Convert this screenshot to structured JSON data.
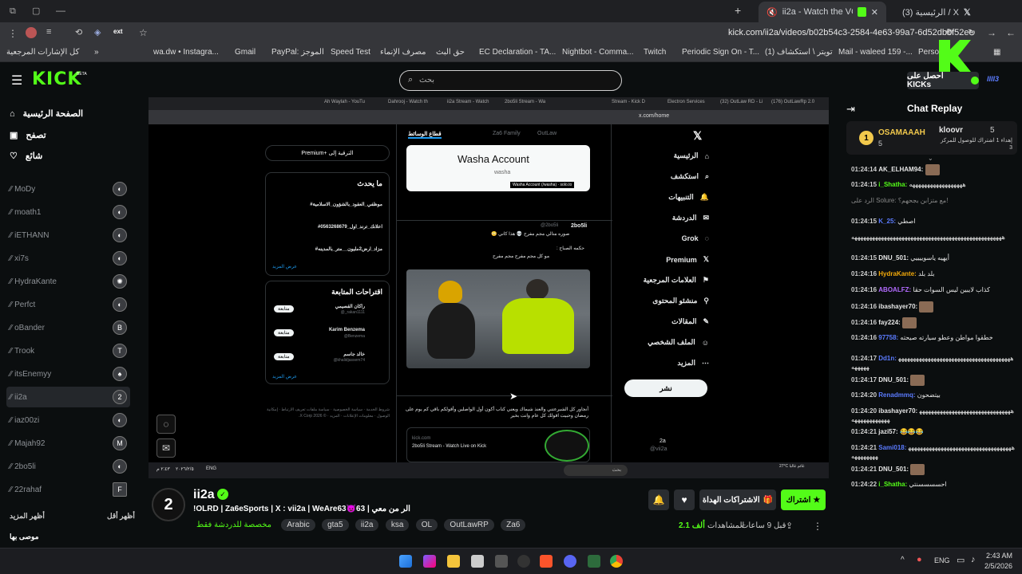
{
  "browser": {
    "tabs": [
      {
        "label": "ii2a - Watch the VOD on Ki",
        "active": true
      },
      {
        "label": "X / الرئيسية (3)",
        "active": false
      }
    ],
    "url": "kick.com/ii2a/videos/b02b54c3-2584-4e63-99a7-6d52dbbf52ee",
    "bookmarks": [
      "كل الإشارات المرجعية",
      "wa.dw • Instagra...",
      "Gmail",
      "PayPal: الموجز",
      "Speed Test",
      "مصرف الإنماء",
      "حق البث",
      "EC Declaration - TA...",
      "Nightbot - Comma...",
      "Twitch",
      "Periodic Sign On - T...",
      "(1) تويتر \\ استكشاف",
      "Mail - waleed 159 -...",
      "Perso"
    ]
  },
  "kick": {
    "logo": "KICK",
    "beta": "BETA",
    "search_placeholder": "بحث",
    "get_kicks": "احصل على KICKs"
  },
  "sidebar": {
    "nav": [
      {
        "label": "الصفحة الرئيسية",
        "icon": "home-icon"
      },
      {
        "label": "تصفح",
        "icon": "browse-icon"
      },
      {
        "label": "شائع",
        "icon": "heart-icon"
      }
    ],
    "channels": [
      "MoDy",
      "moath1",
      "iETHANN",
      "xi7s",
      "HydraKante",
      "Perfct",
      "oBander",
      "Trook",
      "itsEnemyy",
      "ii2a",
      "iaz00zi",
      "Majah92",
      "2bo5li",
      "22rahaf"
    ],
    "show_more": "أظهر المزيد",
    "show_less": "أظهر أقل",
    "recommended": "موصى بها"
  },
  "video_content": {
    "x_tabs": [
      "Ah Waylah - YouTu",
      "Dahrooj - Watch th",
      "ii2a Stream - Watch",
      "2bo5li Stream - Wa",
      "Stream - Kick D",
      "Electron Services",
      "(32) OutLaw RD - Li",
      "(176) OutLawRp 2.0"
    ],
    "x_url": "x.com/home",
    "x_nav": [
      "الرئيسية",
      "استكشف",
      "التنبيهات",
      "الدردشة",
      "Grok",
      "Premium",
      "العلامات المرجعية",
      "منشئو المحتوى",
      "المقالات",
      "الملف الشخصي",
      "المزيد"
    ],
    "post_button": "نشر",
    "profile_name": "2a",
    "profile_handle": "@vii2a",
    "feed_tab": "قطاع الوسائط",
    "feed_tabs_other": [
      "Za6 Family",
      "OutLaw"
    ],
    "card_title": "Washa Account",
    "card_sub": "washa",
    "card_caption": "Washa Account (/washa) · solo.to",
    "post1_user": "2bo5li",
    "post1_handle": "@2bo5li",
    "post1_text1": "صوره متالي مجم مفرح 💀 هذا كاني 😳",
    "post1_text2": "حكمه الصباح :",
    "post1_text3": "مو كل مجم مفرح مجم مفرح",
    "post2_text": "أنجاور كل الشيرعتني والعنذ شيماك ويعني كناب أكون أول الواصلين وأقولكم باقي كم يوم على رمضان وحبيت اقولك كل عام وانت بخير",
    "post2_link": "kick.com",
    "post2_linktitle": "2bo5li Stream - Watch Live on Kick",
    "premium_btn": "Premium+ الترقية إلى",
    "trending_title": "ما يحدث",
    "trends": [
      "#موظفي_العقود_بالشؤون_الاسلامية",
      "#اعلانك_ترند_اول_0563268679",
      "#مزاد_ارض2مليون__متر_بالمدينه"
    ],
    "trend_more": "عرض المزيد",
    "follow_title": "اقتراحات المتابعة",
    "follows": [
      {
        "name": "راكان القصيمي",
        "handle": "@_rakan1111"
      },
      {
        "name": "Karim Benzema",
        "handle": "@Benzema"
      },
      {
        "name": "خالد جاسم",
        "handle": "@khalidjassem74"
      }
    ],
    "follow_btn": "متابعة",
    "footer": [
      "شروط الخدمة",
      "سياسة الخصوصية",
      "سياسة ملفات تعريف الارتباط",
      "إمكانية الوصول",
      "معلومات الإعلانات",
      "المزيد",
      "© 2026 X Corp."
    ],
    "win_search": "بحث",
    "win_time": "٢:٤٣ م",
    "win_date": "٢٠٢٦/٢/٥",
    "win_lang": "ENG",
    "weather": "27°C غائم غالبا"
  },
  "chat": {
    "title": "Chat Replay",
    "top_user": "OSAMAAAH",
    "top_user_count": "5",
    "top2_user": "kloovr",
    "top2_count": "5",
    "top2_text": "إهداء 1 اشتراك للوصول للمركز 3",
    "messages": [
      {
        "time": "01:24:14",
        "user": "AK_ELHAM94:",
        "color": "#e6e6e6",
        "text": ""
      },
      {
        "time": "01:24:15",
        "user": "i_Shatha:",
        "color": "#53fc18",
        "text": "ههههههههههههههههههه"
      },
      {
        "time": "",
        "user": "",
        "color": "#888",
        "text": "الرد على Solure: مع متزابن بجحهم؟!"
      },
      {
        "time": "01:24:15",
        "user": "K_25:",
        "color": "#5b7bff",
        "text": "اصطي"
      },
      {
        "time": "",
        "user": "",
        "color": "#e6e6e6",
        "text": "هههههههههههههههههههههههههههههههههههههههههههههههههههه"
      },
      {
        "time": "01:24:15",
        "user": "DNU_501:",
        "color": "#e6e6e6",
        "text": "أيهيه ياسوييييي"
      },
      {
        "time": "01:24:16",
        "user": "HydraKante:",
        "color": "#f2a90a",
        "text": "بلد بلد"
      },
      {
        "time": "01:24:16",
        "user": "ABOALFZ:",
        "color": "#b36bff",
        "text": "كذاب لايبين ليس السوات حقا"
      },
      {
        "time": "01:24:16",
        "user": "ibashayer70:",
        "color": "#e6e6e6",
        "text": ""
      },
      {
        "time": "01:24:16",
        "user": "fay224:",
        "color": "#e6e6e6",
        "text": ""
      },
      {
        "time": "01:24:16",
        "user": "97758:",
        "color": "#5b7bff",
        "text": "خطقوا مواطن وعطو سيارته صيحته"
      },
      {
        "time": "01:24:17",
        "user": "Dd1n:",
        "color": "#5b7bff",
        "text": "ههههههههههههههههههههههههههههههههههههههههههههه"
      },
      {
        "time": "01:24:17",
        "user": "DNU_501:",
        "color": "#e6e6e6",
        "text": ""
      },
      {
        "time": "01:24:20",
        "user": "Renadmmq:",
        "color": "#5b7bff",
        "text": "بيتضحون"
      },
      {
        "time": "01:24:20",
        "user": "ibashayer70:",
        "color": "#e6e6e6",
        "text": "ههههههههههههههههههههههههههههههههههههههههههههه"
      },
      {
        "time": "01:24:21",
        "user": "jazi57:",
        "color": "#e6e6e6",
        "text": "😂😂😂"
      },
      {
        "time": "01:24:21",
        "user": "Sami018:",
        "color": "#5b7bff",
        "text": "ههههههههههههههههههههههههههههههههههههههههههههه"
      },
      {
        "time": "01:24:21",
        "user": "DNU_501:",
        "color": "#e6e6e6",
        "text": ""
      },
      {
        "time": "01:24:22",
        "user": "i_Shatha:",
        "color": "#53fc18",
        "text": "احسسسسنتي"
      }
    ]
  },
  "streamer": {
    "name": "ii2a",
    "title": "!OLRD | Za6eSports | X : vii2a | WeAre63👿63 | الر من معي",
    "tags": [
      "Arabic",
      "gta5",
      "ii2a",
      "ksa",
      "OL",
      "OutLawRP",
      "Za6"
    ],
    "subscribers_only": "مخصصة للدردشة فقط",
    "subscribe": "اشتراك",
    "gift": "الاشتراكات الهداة",
    "views": "2.1 ألف",
    "views_label": "المشاهدات",
    "ago": "قبل 9 ساعات"
  },
  "taskbar": {
    "time": "2:43 AM",
    "date": "2/5/2026",
    "lang": "ENG"
  },
  "colors": {
    "accent": "#53fc18",
    "bg": "#0b0e0f"
  }
}
